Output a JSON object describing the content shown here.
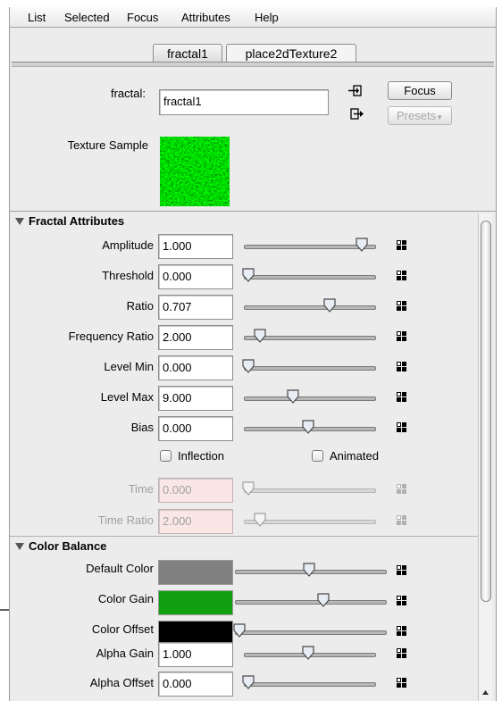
{
  "menu": [
    "List",
    "Selected",
    "Focus",
    "Attributes",
    "Help"
  ],
  "tabs": [
    "fractal1",
    "place2dTexture2"
  ],
  "header": {
    "node_label": "fractal:",
    "node_name": "fractal1",
    "focus_label": "Focus",
    "presets_label": "Presets",
    "texture_sample_label": "Texture Sample"
  },
  "fractal_section": {
    "title": "Fractal Attributes",
    "rows": [
      {
        "label": "Amplitude",
        "value": "1.000",
        "slider": 0.95,
        "disabled": false
      },
      {
        "label": "Threshold",
        "value": "0.000",
        "slider": 0.0,
        "disabled": false
      },
      {
        "label": "Ratio",
        "value": "0.707",
        "slider": 0.68,
        "disabled": false
      },
      {
        "label": "Frequency Ratio",
        "value": "2.000",
        "slider": 0.1,
        "disabled": false
      },
      {
        "label": "Level Min",
        "value": "0.000",
        "slider": 0.0,
        "disabled": false
      },
      {
        "label": "Level Max",
        "value": "9.000",
        "slider": 0.37,
        "disabled": false
      },
      {
        "label": "Bias",
        "value": "0.000",
        "slider": 0.5,
        "disabled": false
      }
    ],
    "checkboxes": [
      {
        "label": "Inflection",
        "checked": false
      },
      {
        "label": "Animated",
        "checked": false
      }
    ],
    "disabled_rows": [
      {
        "label": "Time",
        "value": "0.000",
        "slider": 0.0
      },
      {
        "label": "Time Ratio",
        "value": "2.000",
        "slider": 0.1
      }
    ]
  },
  "color_section": {
    "title": "Color Balance",
    "color_rows": [
      {
        "label": "Default Color",
        "color": "#808080",
        "slider": 0.5
      },
      {
        "label": "Color Gain",
        "color": "#10a010",
        "slider": 0.6
      },
      {
        "label": "Color Offset",
        "color": "#000000",
        "slider": 0.0
      }
    ],
    "numeric_rows": [
      {
        "label": "Alpha Gain",
        "value": "1.000",
        "slider": 0.5
      },
      {
        "label": "Alpha Offset",
        "value": "0.000",
        "slider": 0.0
      }
    ]
  }
}
